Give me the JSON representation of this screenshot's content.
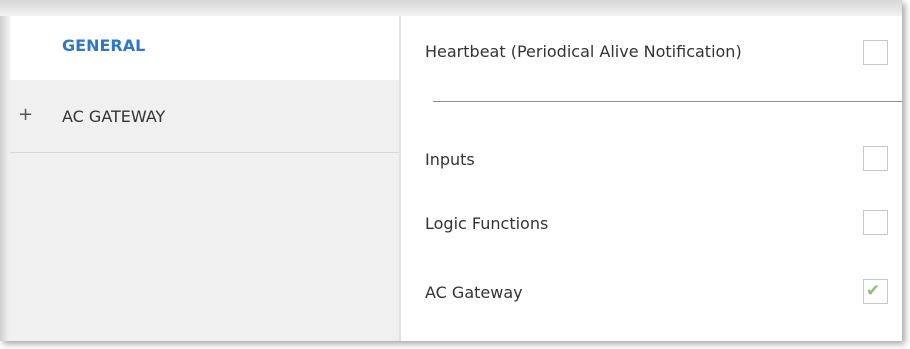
{
  "sidebar": {
    "items": [
      {
        "label": "GENERAL",
        "expand_icon": "",
        "selected": true
      },
      {
        "label": "AC GATEWAY",
        "expand_icon": "+",
        "selected": false
      }
    ]
  },
  "parameters": [
    {
      "label": "Heartbeat (Periodical Alive Notification)",
      "checked": false
    },
    {
      "label": "Inputs",
      "checked": false
    },
    {
      "label": "Logic Functions",
      "checked": false
    },
    {
      "label": "AC Gateway",
      "checked": true
    }
  ],
  "icons": {
    "check": "✔"
  },
  "colors": {
    "selected_text": "#2f79c4",
    "check": "#8fbf7f",
    "sidebar_bg": "#f0f0f0"
  }
}
